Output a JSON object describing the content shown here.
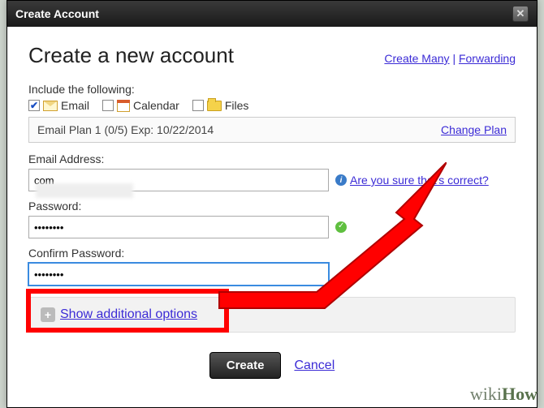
{
  "titlebar": {
    "title": "Create Account"
  },
  "header": {
    "title": "Create a new account",
    "links": {
      "create_many": "Create Many",
      "forwarding": "Forwarding"
    }
  },
  "include": {
    "label": "Include the following:",
    "email": "Email",
    "calendar": "Calendar",
    "files": "Files",
    "email_checked": true,
    "calendar_checked": false,
    "files_checked": false
  },
  "plan": {
    "text": "Email Plan 1 (0/5) Exp: 10/22/2014",
    "change": "Change Plan"
  },
  "fields": {
    "email_label": "Email Address:",
    "email_value": "com",
    "email_hint": "Are you sure that's correct?",
    "password_label": "Password:",
    "password_value": "••••••••",
    "confirm_label": "Confirm Password:",
    "confirm_value": "••••••••"
  },
  "options": {
    "show": "Show additional options"
  },
  "footer": {
    "create": "Create",
    "cancel": "Cancel"
  },
  "watermark": "wikiHow"
}
